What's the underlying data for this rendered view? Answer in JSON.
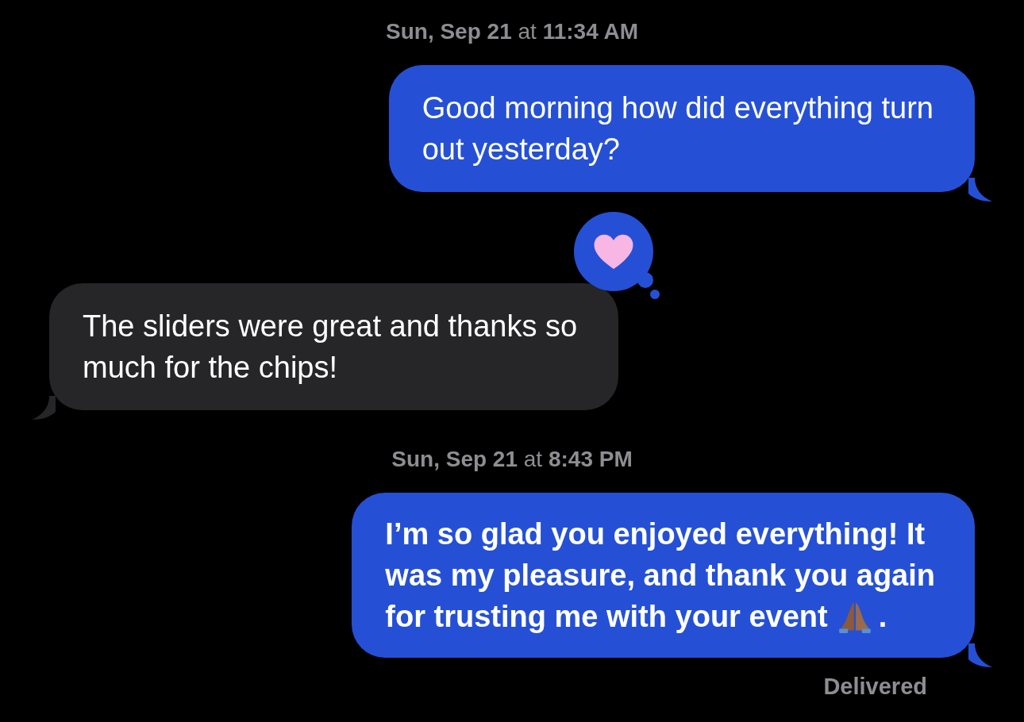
{
  "items": [
    {
      "kind": "timestamp",
      "day": "Sun, Sep 21",
      "joiner": "at",
      "time": "11:34 AM"
    },
    {
      "kind": "message",
      "from_me": true,
      "bold": false,
      "lines": [
        [
          {
            "kind": "text",
            "text": "Good morning how did everything turn"
          }
        ],
        [
          {
            "kind": "text",
            "text": "out yesterday?"
          }
        ]
      ]
    },
    {
      "kind": "message",
      "from_me": false,
      "bold": false,
      "reaction": {
        "kind": "heart"
      },
      "lines": [
        [
          {
            "kind": "text",
            "text": "The sliders were great and thanks so"
          }
        ],
        [
          {
            "kind": "text",
            "text": "much for the chips!"
          }
        ]
      ]
    },
    {
      "kind": "timestamp",
      "day": "Sun, Sep 21",
      "joiner": "at",
      "time": "8:43 PM"
    },
    {
      "kind": "message",
      "from_me": true,
      "bold": true,
      "lines": [
        [
          {
            "kind": "text",
            "text": "I’m so glad you enjoyed everything! It"
          }
        ],
        [
          {
            "kind": "text",
            "text": "was my pleasure, and thank you again"
          }
        ],
        [
          {
            "kind": "text",
            "text": "for trusting me with your event"
          },
          {
            "kind": "emoji"
          },
          {
            "kind": "text",
            "text": "."
          }
        ]
      ]
    },
    {
      "kind": "status",
      "text": "Delivered"
    }
  ]
}
